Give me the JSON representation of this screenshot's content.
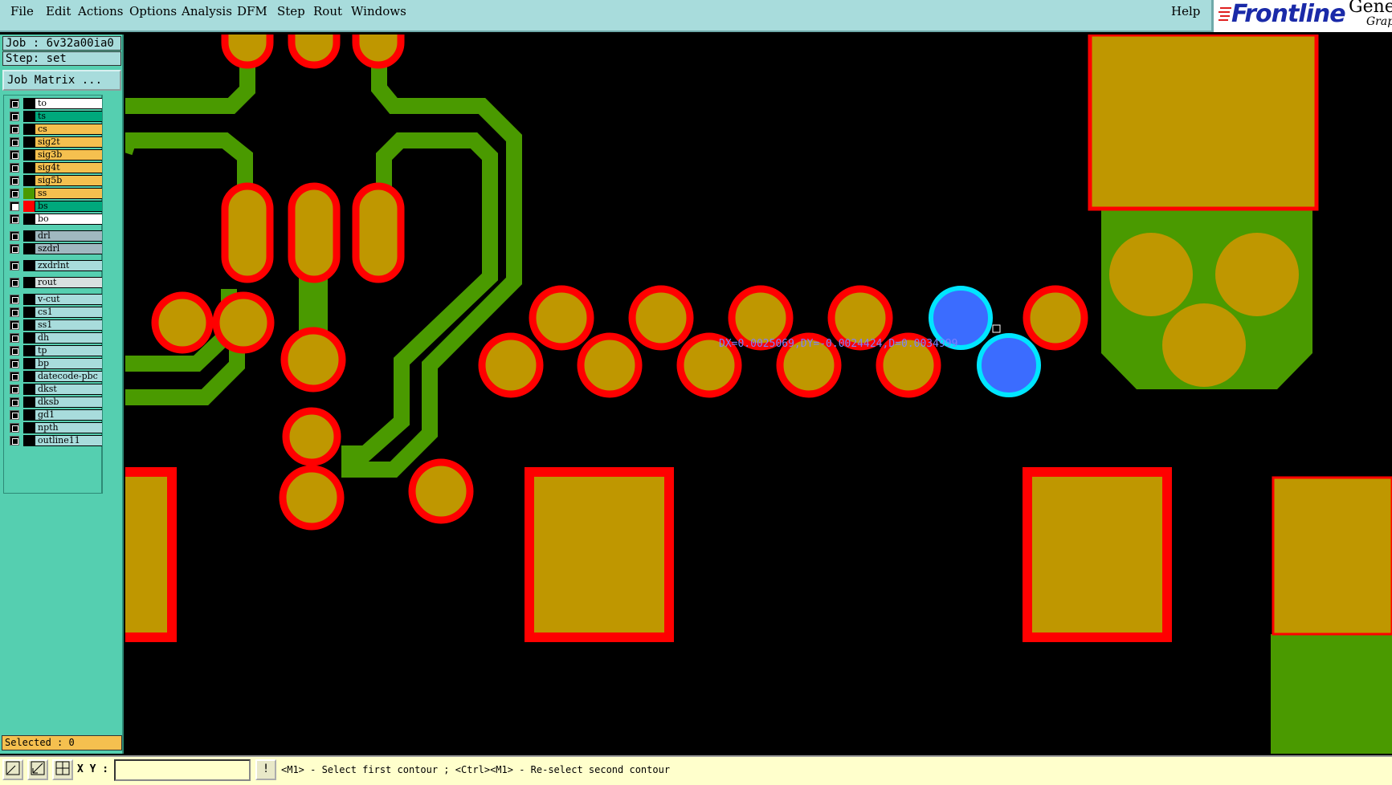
{
  "menubar": {
    "items": [
      "File",
      "Edit",
      "Actions",
      "Options",
      "Analysis",
      "DFM",
      "Step",
      "Rout",
      "Windows"
    ],
    "help": "Help",
    "logo": "Frontline",
    "logo_product": "Genes",
    "logo_sub": "Graph"
  },
  "left_panel": {
    "job": "Job : 6v32a00ia0",
    "step": "Step: set",
    "job_matrix_button": "Job Matrix ...",
    "selected": "Selected : 0"
  },
  "layers": [
    {
      "name": "to",
      "bg": "#ffffff",
      "swatch": "#000000",
      "active": false
    },
    {
      "name": "ts",
      "bg": "#00a87c",
      "swatch": "#000000",
      "active": false
    },
    {
      "name": "cs",
      "bg": "#f5c04f",
      "swatch": "#000000",
      "active": false
    },
    {
      "name": "sig2t",
      "bg": "#f5c04f",
      "swatch": "#000000",
      "active": false
    },
    {
      "name": "sig3b",
      "bg": "#f5c04f",
      "swatch": "#000000",
      "active": false
    },
    {
      "name": "sig4t",
      "bg": "#f5c04f",
      "swatch": "#000000",
      "active": false
    },
    {
      "name": "sig5b",
      "bg": "#f5c04f",
      "swatch": "#000000",
      "active": false
    },
    {
      "name": "ss",
      "bg": "#f5c04f",
      "swatch": "#4a9a00",
      "active": false
    },
    {
      "name": "bs",
      "bg": "#00a87c",
      "swatch": "#ff0000",
      "active": true
    },
    {
      "name": "bo",
      "bg": "#ffffff",
      "swatch": "#000000",
      "active": false
    },
    {
      "name": "drl",
      "bg": "#a0b8c0",
      "swatch": "#000000",
      "active": false
    },
    {
      "name": "szdrl",
      "bg": "#a0b8c0",
      "swatch": "#000000",
      "active": false
    },
    {
      "name": "zxdrlnt",
      "bg": "#a8dcdc",
      "swatch": "#000000",
      "active": false
    },
    {
      "name": "rout",
      "bg": "#d8e0e0",
      "swatch": "#000000",
      "active": false
    },
    {
      "name": "v-cut",
      "bg": "#a8dcdc",
      "swatch": "#000000",
      "active": false
    },
    {
      "name": "cs1",
      "bg": "#a8dcdc",
      "swatch": "#000000",
      "active": false
    },
    {
      "name": "ss1",
      "bg": "#a8dcdc",
      "swatch": "#000000",
      "active": false
    },
    {
      "name": "dh",
      "bg": "#a8dcdc",
      "swatch": "#000000",
      "active": false
    },
    {
      "name": "tp",
      "bg": "#a8dcdc",
      "swatch": "#000000",
      "active": false
    },
    {
      "name": "bp",
      "bg": "#a8dcdc",
      "swatch": "#000000",
      "active": false
    },
    {
      "name": "datecode-pbc",
      "bg": "#a8dcdc",
      "swatch": "#000000",
      "active": false
    },
    {
      "name": "dkst",
      "bg": "#a8dcdc",
      "swatch": "#000000",
      "active": false
    },
    {
      "name": "dksb",
      "bg": "#a8dcdc",
      "swatch": "#000000",
      "active": false
    },
    {
      "name": "gd1",
      "bg": "#a8dcdc",
      "swatch": "#000000",
      "active": false
    },
    {
      "name": "npth",
      "bg": "#a8dcdc",
      "swatch": "#000000",
      "active": false
    },
    {
      "name": "outline11",
      "bg": "#a8dcdc",
      "swatch": "#000000",
      "active": false
    }
  ],
  "canvas": {
    "measurement": "DX=0.0025069,DY=-0.0024424,D=0.0034999"
  },
  "status": {
    "xy_label": "X Y :",
    "xy_value": "",
    "prompt": "<M1> - Select first contour ; <Ctrl><M1> - Re-select second contour"
  },
  "colors": {
    "pad": "#bf9700",
    "outline": "#ff0000",
    "trace": "#4a9a00",
    "highlight": "#3b6cff",
    "highlight_ring": "#00e5ff",
    "menubar": "#a8dcdc",
    "panel": "#55cfb0"
  }
}
